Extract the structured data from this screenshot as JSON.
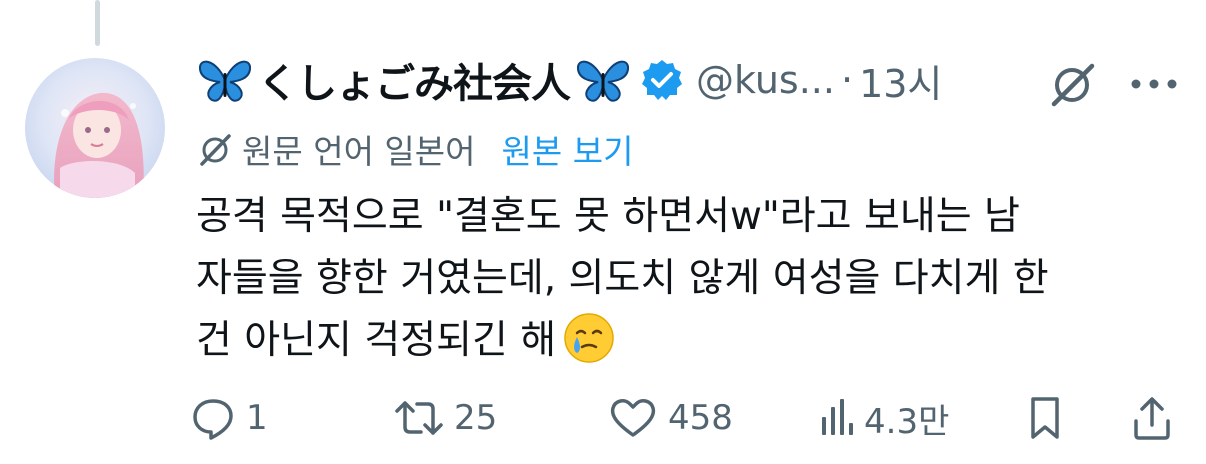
{
  "author": {
    "display_name": "くしょごみ社会人",
    "handle": "@kus...",
    "separator": "·",
    "time": "13시"
  },
  "translation": {
    "info": "원문 언어 일본어",
    "show_original": "원본 보기"
  },
  "body": {
    "line1": "공격 목적으로 \"결혼도 못 하면서w\"라고 보내는 남",
    "line2": "자들을 향한 거였는데, 의도치 않게 여성을 다치게 한",
    "line3": "건 아닌지 걱정되긴 해"
  },
  "actions": {
    "replies": "1",
    "reposts": "25",
    "likes": "458",
    "views": "4.3만"
  },
  "icons": {
    "emoji": "face-holding-back-tears-emoji",
    "verified": "verified-badge-icon"
  },
  "colors": {
    "accent": "#1d9bf0",
    "muted": "#536471",
    "text": "#0f1419"
  }
}
